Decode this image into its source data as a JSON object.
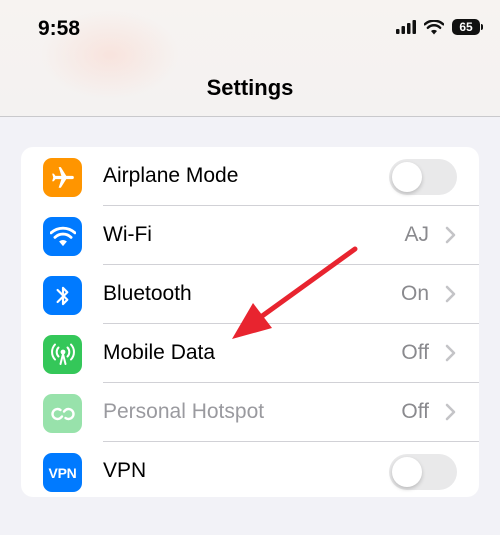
{
  "status_bar": {
    "time": "9:58",
    "battery_level": "65",
    "icons": [
      "cellular-signal-icon",
      "wifi-icon",
      "battery-icon"
    ]
  },
  "header": {
    "title": "Settings"
  },
  "settings": {
    "rows": [
      {
        "label": "Airplane Mode",
        "icon": "airplane-icon",
        "icon_color": "#ff9500",
        "control": "toggle",
        "toggle_on": false
      },
      {
        "label": "Wi-Fi",
        "icon": "wifi-icon",
        "icon_color": "#007aff",
        "value": "AJ",
        "control": "chevron"
      },
      {
        "label": "Bluetooth",
        "icon": "bluetooth-icon",
        "icon_color": "#007aff",
        "value": "On",
        "control": "chevron"
      },
      {
        "label": "Mobile Data",
        "icon": "antenna-icon",
        "icon_color": "#34c759",
        "value": "Off",
        "control": "chevron"
      },
      {
        "label": "Personal Hotspot",
        "icon": "hotspot-icon",
        "icon_color": "#34c759",
        "value": "Off",
        "control": "chevron",
        "disabled": true
      },
      {
        "label": "VPN",
        "icon": "vpn-icon",
        "icon_color": "#007aff",
        "icon_text": "VPN",
        "control": "toggle",
        "toggle_on": false
      }
    ]
  },
  "annotation": {
    "type": "arrow",
    "color": "#e8242f",
    "points_to": "Mobile Data"
  }
}
